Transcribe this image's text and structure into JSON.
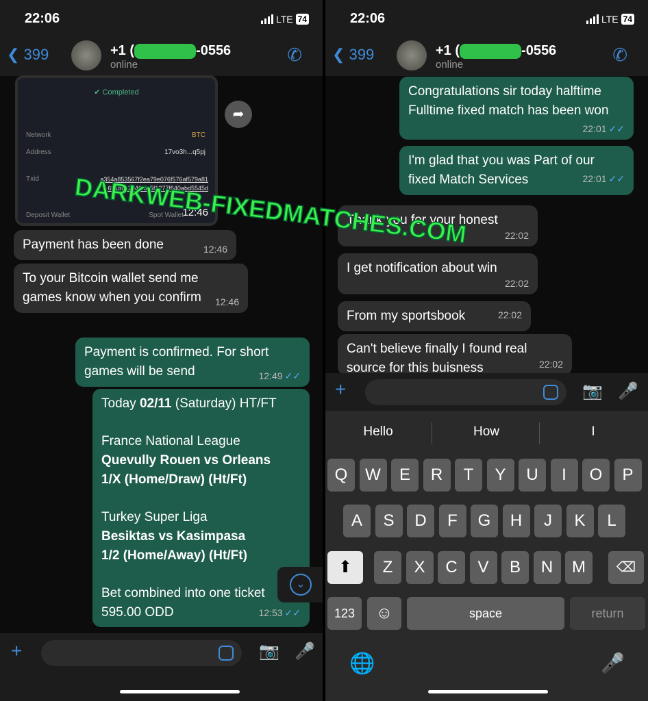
{
  "watermark": "DARKWEB-FIXEDMATCHES.COM",
  "status": {
    "time": "22:06",
    "network": "LTE",
    "battery": "74"
  },
  "header": {
    "back_count": "399",
    "contact_prefix": "+1 (",
    "contact_suffix": "-0556",
    "presence": "online"
  },
  "left": {
    "receipt": {
      "status": "Completed",
      "rows": [
        {
          "label": "Network",
          "value": "BTC"
        },
        {
          "label": "Address",
          "value": "17vo3h...q5pj"
        },
        {
          "label": "Txid",
          "value": "a354a853567f2ea79e076f576af579a816918c12946f6c5f1277f640abd5545d"
        },
        {
          "label": "Deposit Wallet",
          "value": "Spot Wallet"
        }
      ],
      "time": "12:46"
    },
    "messages": [
      {
        "dir": "in",
        "text": "Payment has been done",
        "time": "12:46"
      },
      {
        "dir": "in",
        "text": "To your Bitcoin wallet send me games know when you confirm",
        "time": "12:46"
      },
      {
        "dir": "out",
        "text": "Payment is confirmed. For short games will be send",
        "time": "12:49"
      }
    ],
    "tips": {
      "line1_prefix": "Today ",
      "date": "02/11",
      "line1_suffix": " (Saturday) HT/FT",
      "league1": "France National League",
      "match1": "Quevully Rouen vs Orleans",
      "pick1": "1/X (Home/Draw) (Ht/Ft)",
      "league2": "Turkey Super Liga",
      "match2": "Besiktas vs Kasimpasa",
      "pick2": "1/2 (Home/Away) (Ht/Ft)",
      "combined": "Bet combined into one ticket",
      "odd": "595.00 ODD",
      "time": "12:53"
    }
  },
  "right": {
    "messages": [
      {
        "dir": "out",
        "text": "Congratulations sir today halftime Fulltime fixed match has been won",
        "time": "22:01"
      },
      {
        "dir": "out",
        "text": "I'm glad that you was Part of our fixed Match Services",
        "time": "22:01"
      },
      {
        "dir": "in",
        "text": "Thank you for your honest",
        "time": "22:02"
      },
      {
        "dir": "in",
        "text": "I get notification about win",
        "time": "22:02"
      },
      {
        "dir": "in",
        "text": "From my sportsbook",
        "time": "22:02"
      },
      {
        "dir": "in",
        "text": "Can't believe finally I found real source for this buisness",
        "time": "22:02"
      }
    ],
    "suggestions": [
      "Hello",
      "How",
      "I"
    ],
    "keyboard": {
      "row1": [
        "Q",
        "W",
        "E",
        "R",
        "T",
        "Y",
        "U",
        "I",
        "O",
        "P"
      ],
      "row2": [
        "A",
        "S",
        "D",
        "F",
        "G",
        "H",
        "J",
        "K",
        "L"
      ],
      "row3": [
        "Z",
        "X",
        "C",
        "V",
        "B",
        "N",
        "M"
      ],
      "numbers": "123",
      "space": "space",
      "return": "return"
    }
  },
  "colors": {
    "outgoing": "#1e5c4b",
    "incoming": "#2e2e2e",
    "accent": "#3f8bd8",
    "watermark": "#3ef04a"
  }
}
